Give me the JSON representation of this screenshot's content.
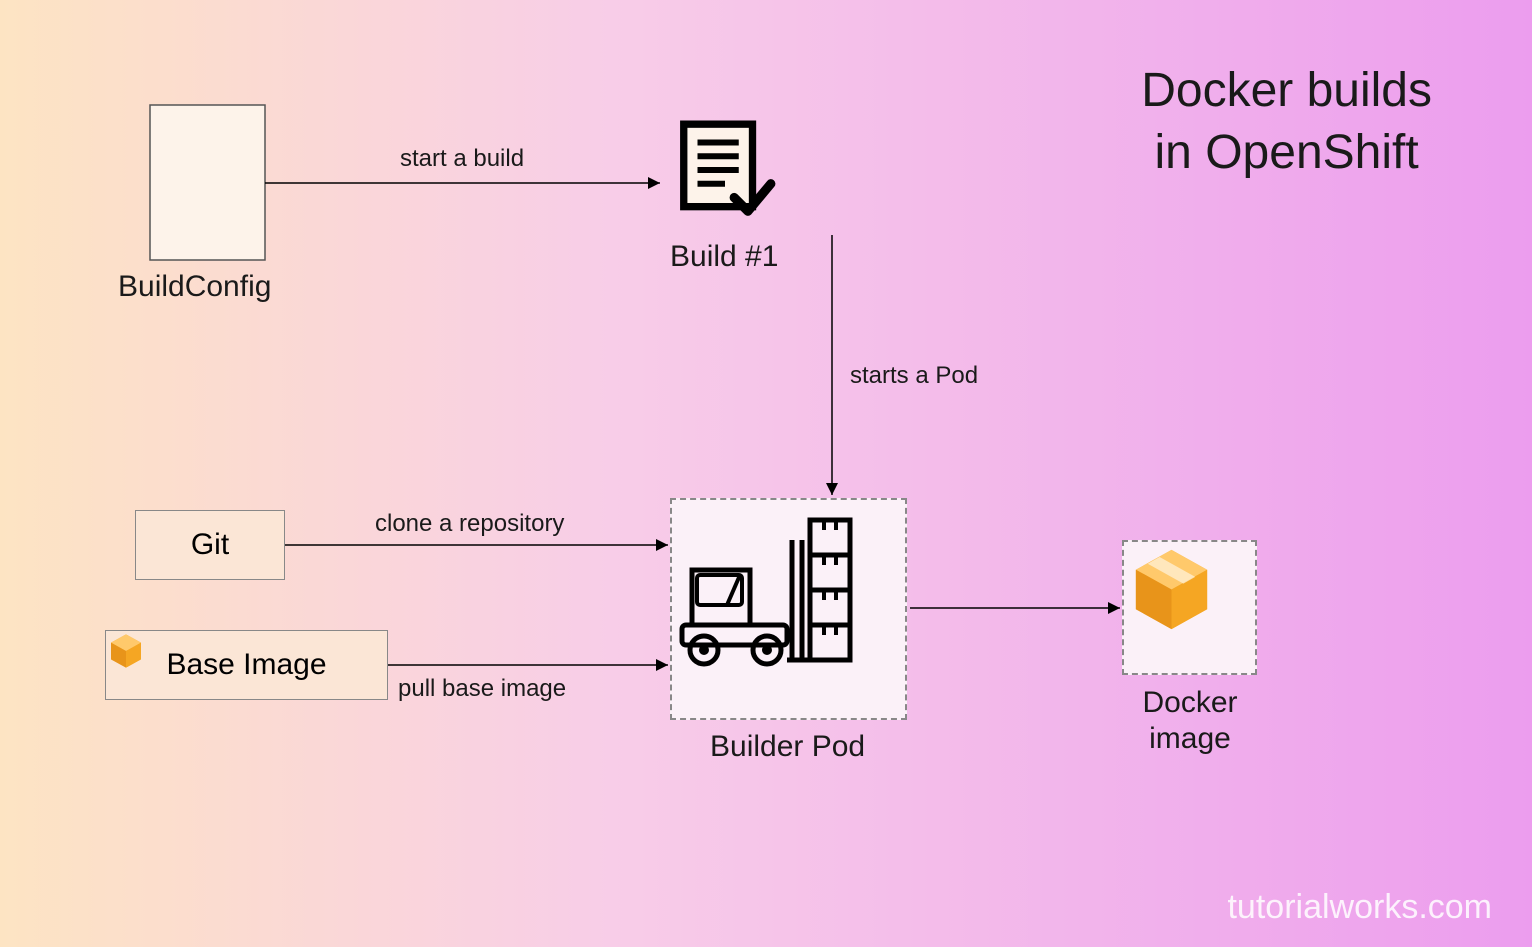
{
  "title_line1": "Docker builds",
  "title_line2": "in OpenShift",
  "watermark": "tutorialworks.com",
  "nodes": {
    "buildconfig": {
      "label": "BuildConfig"
    },
    "build": {
      "label": "Build #1"
    },
    "git": {
      "label": "Git"
    },
    "baseimage": {
      "label": "Base Image"
    },
    "builderpod": {
      "label": "Builder Pod"
    },
    "dockerimage_line1": "Docker",
    "dockerimage_line2": "image"
  },
  "edges": {
    "start_build": "start a build",
    "starts_pod": "starts a Pod",
    "clone_repo": "clone a repository",
    "pull_base": "pull base image"
  }
}
